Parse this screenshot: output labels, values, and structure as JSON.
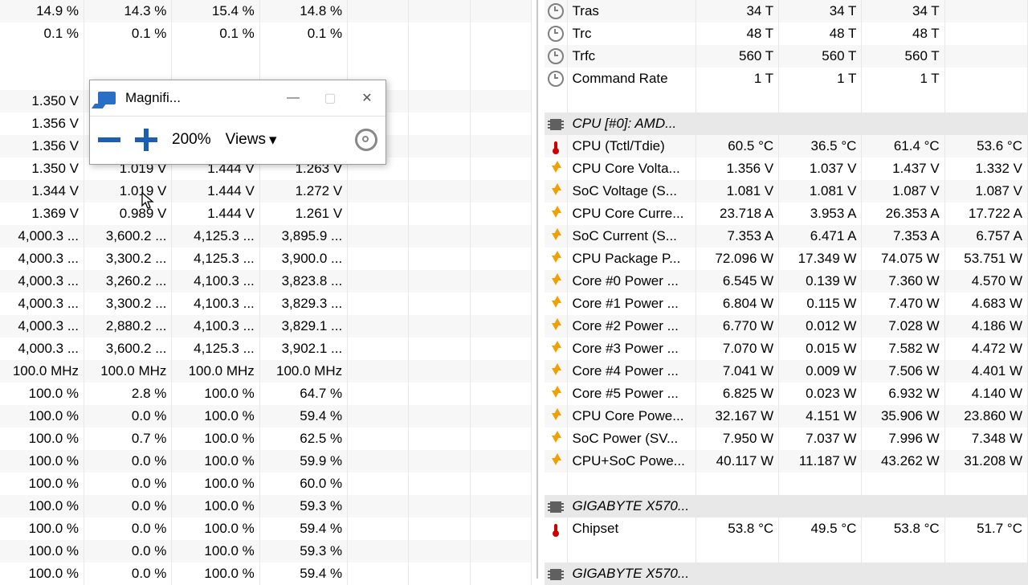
{
  "magnifier": {
    "title": "Magnifi...",
    "zoom": "200%",
    "views": "Views"
  },
  "left_rows": [
    {
      "c": [
        "14.9 %",
        "14.3 %",
        "15.4 %",
        "14.8 %"
      ]
    },
    {
      "c": [
        "0.1 %",
        "0.1 %",
        "0.1 %",
        "0.1 %"
      ]
    },
    {
      "c": [
        "",
        "",
        "",
        ""
      ],
      "gap": true
    },
    {
      "c": [
        "",
        "",
        "",
        ""
      ],
      "gap": true
    },
    {
      "c": [
        "1.350 V",
        "",
        "",
        ""
      ]
    },
    {
      "c": [
        "1.356 V",
        "",
        "",
        ""
      ]
    },
    {
      "c": [
        "1.356 V",
        "",
        "",
        ""
      ]
    },
    {
      "c": [
        "1.350 V",
        "1.019 V",
        "1.444 V",
        "1.263 V"
      ]
    },
    {
      "c": [
        "1.344 V",
        "1.019 V",
        "1.444 V",
        "1.272 V"
      ]
    },
    {
      "c": [
        "1.369 V",
        "0.989 V",
        "1.444 V",
        "1.261 V"
      ]
    },
    {
      "c": [
        "4,000.3 ...",
        "3,600.2 ...",
        "4,125.3 ...",
        "3,895.9 ..."
      ]
    },
    {
      "c": [
        "4,000.3 ...",
        "3,300.2 ...",
        "4,125.3 ...",
        "3,900.0 ..."
      ]
    },
    {
      "c": [
        "4,000.3 ...",
        "3,260.2 ...",
        "4,100.3 ...",
        "3,823.8 ..."
      ]
    },
    {
      "c": [
        "4,000.3 ...",
        "3,300.2 ...",
        "4,100.3 ...",
        "3,829.3 ..."
      ]
    },
    {
      "c": [
        "4,000.3 ...",
        "2,880.2 ...",
        "4,100.3 ...",
        "3,829.1 ..."
      ]
    },
    {
      "c": [
        "4,000.3 ...",
        "3,600.2 ...",
        "4,125.3 ...",
        "3,902.1 ..."
      ]
    },
    {
      "c": [
        "100.0 MHz",
        "100.0 MHz",
        "100.0 MHz",
        "100.0 MHz"
      ]
    },
    {
      "c": [
        "100.0 %",
        "2.8 %",
        "100.0 %",
        "64.7 %"
      ]
    },
    {
      "c": [
        "100.0 %",
        "0.0 %",
        "100.0 %",
        "59.4 %"
      ]
    },
    {
      "c": [
        "100.0 %",
        "0.7 %",
        "100.0 %",
        "62.5 %"
      ]
    },
    {
      "c": [
        "100.0 %",
        "0.0 %",
        "100.0 %",
        "59.9 %"
      ]
    },
    {
      "c": [
        "100.0 %",
        "0.0 %",
        "100.0 %",
        "60.0 %"
      ]
    },
    {
      "c": [
        "100.0 %",
        "0.0 %",
        "100.0 %",
        "59.3 %"
      ]
    },
    {
      "c": [
        "100.0 %",
        "0.0 %",
        "100.0 %",
        "59.4 %"
      ]
    },
    {
      "c": [
        "100.0 %",
        "0.0 %",
        "100.0 %",
        "59.3 %"
      ]
    },
    {
      "c": [
        "100.0 %",
        "0.0 %",
        "100.0 %",
        "59.4 %"
      ]
    }
  ],
  "right_rows": [
    {
      "icon": "clock",
      "label": "Tras",
      "v": [
        "34 T",
        "34 T",
        "34 T"
      ]
    },
    {
      "icon": "clock",
      "label": "Trc",
      "v": [
        "48 T",
        "48 T",
        "48 T"
      ]
    },
    {
      "icon": "clock",
      "label": "Trfc",
      "v": [
        "560 T",
        "560 T",
        "560 T"
      ]
    },
    {
      "icon": "clock",
      "label": "Command Rate",
      "v": [
        "1 T",
        "1 T",
        "1 T"
      ]
    },
    {
      "gap": true
    },
    {
      "hdr": true,
      "icon": "chip",
      "label": "CPU [#0]: AMD..."
    },
    {
      "icon": "therm",
      "label": "CPU (Tctl/Tdie)",
      "v": [
        "60.5 °C",
        "36.5 °C",
        "61.4 °C",
        "53.6 °C"
      ]
    },
    {
      "icon": "bolt",
      "label": "CPU Core Volta...",
      "v": [
        "1.356 V",
        "1.037 V",
        "1.437 V",
        "1.332 V"
      ]
    },
    {
      "icon": "bolt",
      "label": "SoC Voltage (S...",
      "v": [
        "1.081 V",
        "1.081 V",
        "1.087 V",
        "1.087 V"
      ]
    },
    {
      "icon": "bolt",
      "label": "CPU Core Curre...",
      "v": [
        "23.718 A",
        "3.953 A",
        "26.353 A",
        "17.722 A"
      ]
    },
    {
      "icon": "bolt",
      "label": "SoC Current (S...",
      "v": [
        "7.353 A",
        "6.471 A",
        "7.353 A",
        "6.757 A"
      ]
    },
    {
      "icon": "bolt",
      "label": "CPU Package P...",
      "v": [
        "72.096 W",
        "17.349 W",
        "74.075 W",
        "53.751 W"
      ]
    },
    {
      "icon": "bolt",
      "label": "Core #0 Power ...",
      "v": [
        "6.545 W",
        "0.139 W",
        "7.360 W",
        "4.570 W"
      ]
    },
    {
      "icon": "bolt",
      "label": "Core #1 Power ...",
      "v": [
        "6.804 W",
        "0.115 W",
        "7.470 W",
        "4.683 W"
      ]
    },
    {
      "icon": "bolt",
      "label": "Core #2 Power ...",
      "v": [
        "6.770 W",
        "0.012 W",
        "7.028 W",
        "4.186 W"
      ]
    },
    {
      "icon": "bolt",
      "label": "Core #3 Power ...",
      "v": [
        "7.070 W",
        "0.015 W",
        "7.582 W",
        "4.472 W"
      ]
    },
    {
      "icon": "bolt",
      "label": "Core #4 Power ...",
      "v": [
        "7.041 W",
        "0.009 W",
        "7.506 W",
        "4.401 W"
      ]
    },
    {
      "icon": "bolt",
      "label": "Core #5 Power ...",
      "v": [
        "6.825 W",
        "0.023 W",
        "6.932 W",
        "4.140 W"
      ]
    },
    {
      "icon": "bolt",
      "label": "CPU Core Powe...",
      "v": [
        "32.167 W",
        "4.151 W",
        "35.906 W",
        "23.860 W"
      ]
    },
    {
      "icon": "bolt",
      "label": "SoC Power (SV...",
      "v": [
        "7.950 W",
        "7.037 W",
        "7.996 W",
        "7.348 W"
      ]
    },
    {
      "icon": "bolt",
      "label": "CPU+SoC Powe...",
      "v": [
        "40.117 W",
        "11.187 W",
        "43.262 W",
        "31.208 W"
      ]
    },
    {
      "gap": true
    },
    {
      "hdr": true,
      "icon": "chip",
      "label": "GIGABYTE X570..."
    },
    {
      "icon": "therm",
      "label": "Chipset",
      "v": [
        "53.8 °C",
        "49.5 °C",
        "53.8 °C",
        "51.7 °C"
      ]
    },
    {
      "gap": true
    },
    {
      "hdr": true,
      "icon": "chip",
      "label": "GIGABYTE X570..."
    }
  ]
}
